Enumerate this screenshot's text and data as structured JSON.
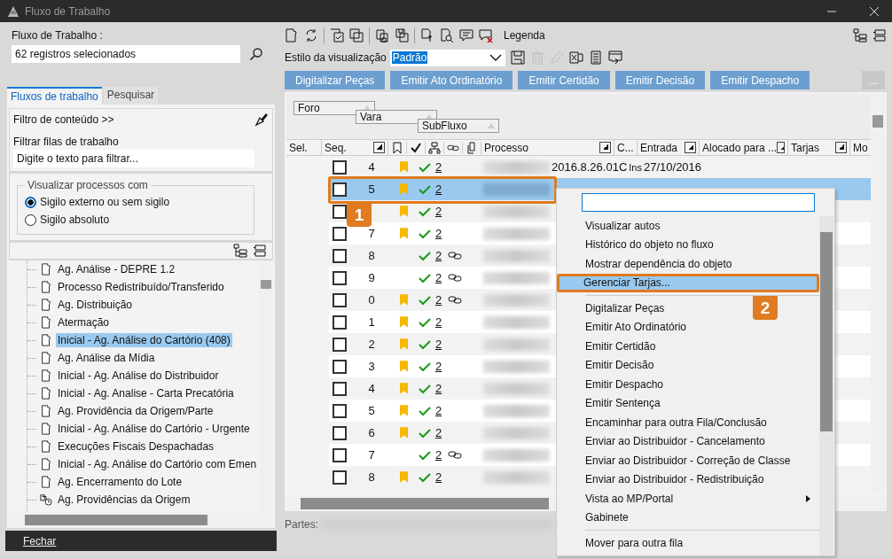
{
  "window": {
    "title": "Fluxo de Trabalho"
  },
  "left": {
    "workflow_label": "Fluxo de Trabalho :",
    "workflow_value": "62 registros selecionados",
    "tabs": [
      {
        "label": "Fluxos de trabalho",
        "selected": true
      },
      {
        "label": "Pesquisar",
        "selected": false
      }
    ],
    "content_filter": "Filtro de conteúdo >>",
    "filter_label": "Filtrar filas de trabalho",
    "filter_placeholder": "Digite o texto para filtrar...",
    "group_title": "Visualizar processos com",
    "radios": [
      {
        "label": "Sigilo externo ou sem sigilo",
        "selected": true
      },
      {
        "label": "Sigilo absoluto",
        "selected": false
      }
    ],
    "tree": [
      {
        "label": "Ag. Análise - DEPRE 1.2",
        "kind": "queue",
        "selected": false
      },
      {
        "label": "Processo Redistribuído/Transferido",
        "kind": "queue",
        "selected": false
      },
      {
        "label": "Ag. Distribuição",
        "kind": "queue",
        "selected": false
      },
      {
        "label": "Atermação",
        "kind": "queue",
        "selected": false
      },
      {
        "label": "Inicial - Ag. Análise do Cartório (408)",
        "kind": "queue",
        "selected": true
      },
      {
        "label": "Ag. Análise da Mídia",
        "kind": "queue",
        "selected": false
      },
      {
        "label": "Inicial  - Ag. Análise do Distribuidor",
        "kind": "queue",
        "selected": false
      },
      {
        "label": "Inicial - Ag. Analise - Carta Precatória",
        "kind": "queue",
        "selected": false
      },
      {
        "label": "Ag. Providência da Origem/Parte",
        "kind": "queue",
        "selected": false
      },
      {
        "label": "Inicial - Ag. Análise do Cartório - Urgente",
        "kind": "queue",
        "selected": false
      },
      {
        "label": "Execuções Fiscais Despachadas",
        "kind": "queue",
        "selected": false
      },
      {
        "label": "Inicial - Ag. Análise do Cartório com Emen",
        "kind": "queue",
        "selected": false
      },
      {
        "label": "Ag. Encerramento do Lote",
        "kind": "queue",
        "selected": false
      },
      {
        "label": "Ag. Providências da Origem",
        "kind": "scheduled",
        "selected": false
      }
    ],
    "close_button": "Fechar"
  },
  "right": {
    "legend": "Legenda",
    "style_label": "Estilo da visualização",
    "style_value": "Padrão",
    "actions": [
      "Digitalizar Peças",
      "Emitir Ato Ordinatório",
      "Emitir Certidão",
      "Emitir Decisão",
      "Emitir Despacho"
    ],
    "more_button": "...",
    "grouping": [
      "Foro",
      "Vara",
      "SubFluxo"
    ],
    "columns": [
      "Sel.",
      "Seq.",
      "Processo",
      "C...",
      "Entrada",
      "Alocado para ...",
      "Tarjas",
      "Mo"
    ],
    "rows": [
      {
        "seq": "4",
        "flagged": true,
        "linked": false,
        "count": "2",
        "selected": false,
        "process_tail": "2016.8.26.01C",
        "c": "Ins",
        "entrada": "27/10/2016"
      },
      {
        "seq": "5",
        "flagged": true,
        "linked": false,
        "count": "2",
        "selected": true
      },
      {
        "flagged": true,
        "linked": false,
        "count": "2",
        "selected": false
      },
      {
        "seq": "7",
        "flagged": true,
        "linked": false,
        "count": "2",
        "selected": false
      },
      {
        "seq": "8",
        "flagged": false,
        "linked": true,
        "count": "2",
        "selected": false
      },
      {
        "seq": "9",
        "flagged": false,
        "linked": true,
        "count": "2",
        "selected": false
      },
      {
        "seq": "0",
        "flagged": true,
        "linked": true,
        "count": "2",
        "selected": false
      },
      {
        "seq": "1",
        "flagged": true,
        "linked": false,
        "count": "2",
        "selected": false
      },
      {
        "seq": "2",
        "flagged": true,
        "linked": false,
        "count": "2",
        "selected": false
      },
      {
        "seq": "3",
        "flagged": true,
        "linked": false,
        "count": "2",
        "selected": false
      },
      {
        "seq": "4",
        "flagged": true,
        "linked": false,
        "count": "2",
        "selected": false
      },
      {
        "seq": "5",
        "flagged": true,
        "linked": false,
        "count": "2",
        "selected": false
      },
      {
        "seq": "6",
        "flagged": true,
        "linked": false,
        "count": "2",
        "selected": false
      },
      {
        "seq": "7",
        "flagged": false,
        "linked": true,
        "count": "2",
        "selected": false
      },
      {
        "seq": "8",
        "flagged": true,
        "linked": false,
        "count": "2",
        "selected": false
      }
    ],
    "parties_label": "Partes:"
  },
  "context_menu": {
    "groups": [
      [
        {
          "label": "Visualizar autos",
          "selected": false,
          "submenu": false
        },
        {
          "label": "Histórico do objeto no fluxo",
          "selected": false,
          "submenu": false
        },
        {
          "label": "Mostrar dependência do objeto",
          "selected": false,
          "submenu": false
        },
        {
          "label": "Gerenciar Tarjas...",
          "selected": true,
          "submenu": false
        }
      ],
      [
        {
          "label": "Digitalizar Peças",
          "selected": false,
          "submenu": false
        },
        {
          "label": "Emitir Ato Ordinatório",
          "selected": false,
          "submenu": false
        },
        {
          "label": "Emitir Certidão",
          "selected": false,
          "submenu": false
        },
        {
          "label": "Emitir Decisão",
          "selected": false,
          "submenu": false
        },
        {
          "label": "Emitir Despacho",
          "selected": false,
          "submenu": false
        },
        {
          "label": "Emitir Sentença",
          "selected": false,
          "submenu": false
        },
        {
          "label": "Encaminhar para outra Fila/Conclusão",
          "selected": false,
          "submenu": false
        },
        {
          "label": "Enviar ao Distribuidor - Cancelamento",
          "selected": false,
          "submenu": false
        },
        {
          "label": "Enviar ao Distribuidor - Correção de Classe",
          "selected": false,
          "submenu": false
        },
        {
          "label": "Enviar ao Distribuidor - Redistribuição",
          "selected": false,
          "submenu": false
        },
        {
          "label": "Vista ao MP/Portal",
          "selected": false,
          "submenu": true
        },
        {
          "label": "Gabinete",
          "selected": false,
          "submenu": false
        }
      ],
      [
        {
          "label": "Mover para outra fila",
          "selected": false,
          "submenu": false
        }
      ]
    ]
  },
  "callouts": [
    "1",
    "2"
  ]
}
